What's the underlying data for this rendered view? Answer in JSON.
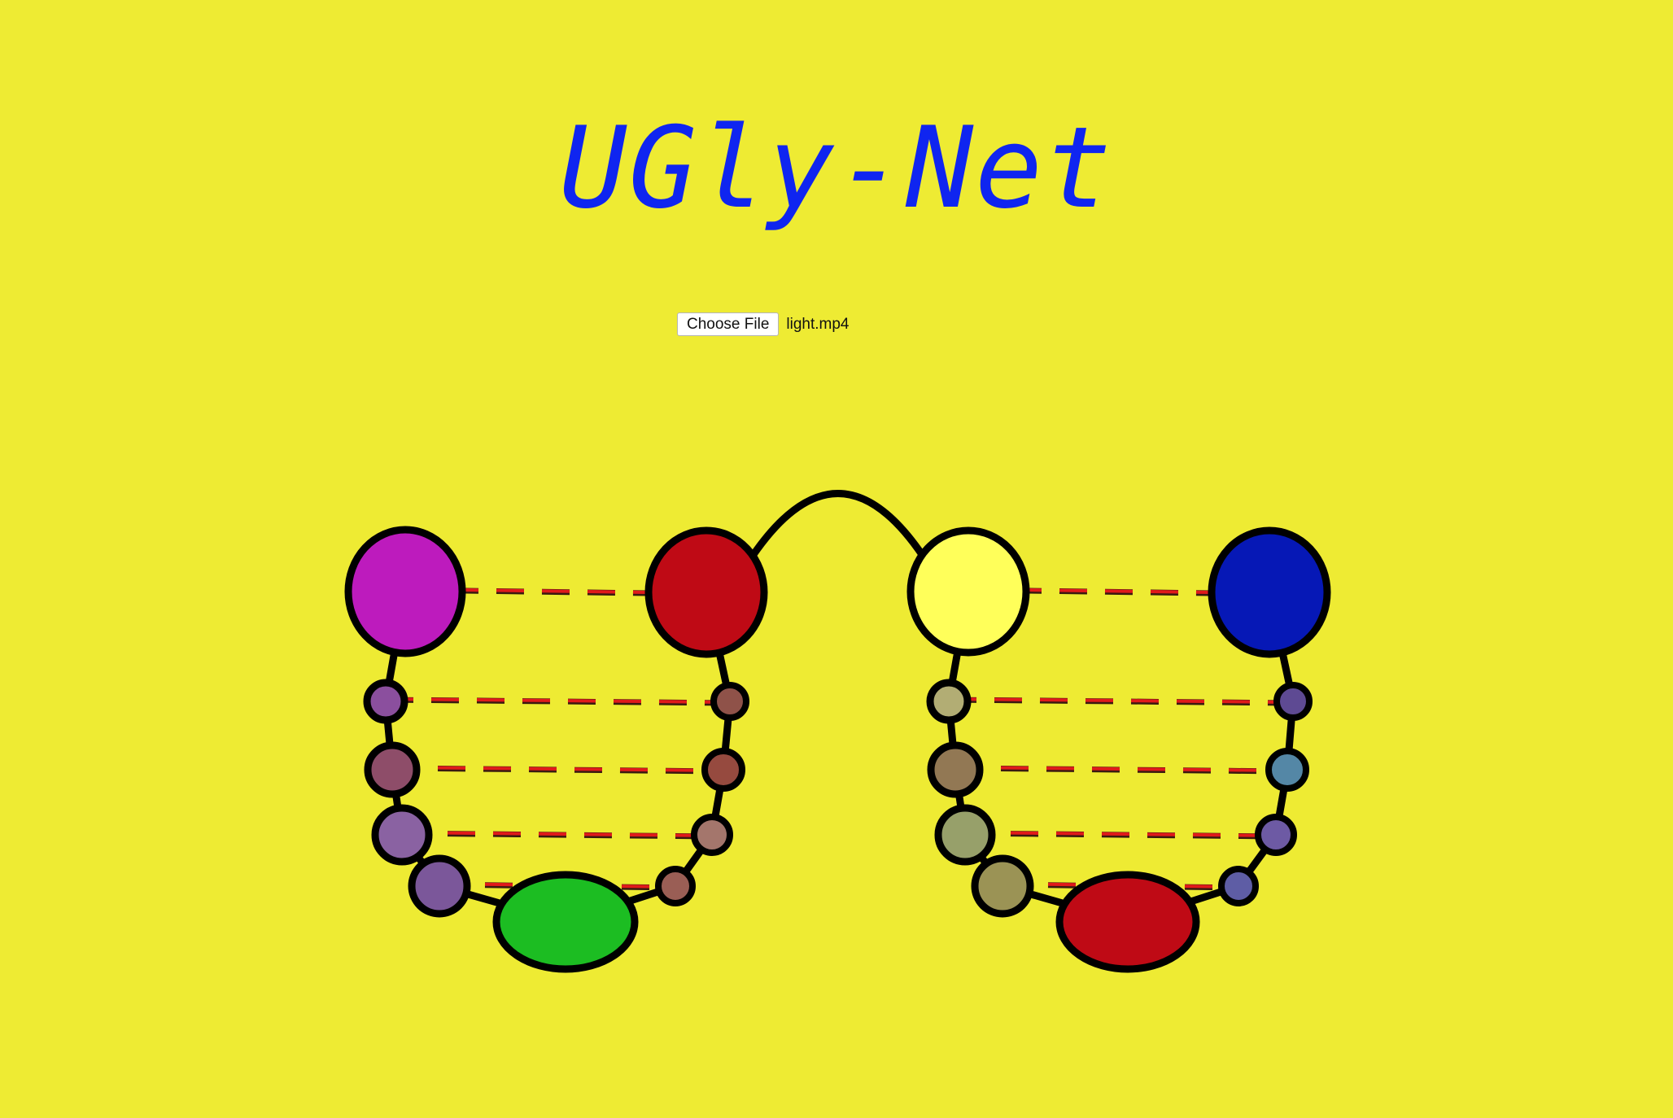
{
  "page": {
    "title": "UGly-Net",
    "background_color": "#eeeb33",
    "title_color": "#0f25f0"
  },
  "file_input": {
    "button_label": "Choose File",
    "file_name": "light.mp4"
  },
  "figure": {
    "link_color": "#000000",
    "skip_connection_color": "#e01a1a",
    "encoders": [
      {
        "big_node_color": "#bd1bbd",
        "chain_colors": [
          "#8b4f9e",
          "#8e4d69",
          "#8a62a2",
          "#7b579a"
        ],
        "bottom_node_color": "#1cbd22"
      },
      {
        "big_node_color": "#ffff5a",
        "chain_colors": [
          "#b2ad74",
          "#927854",
          "#97a06a",
          "#9b9355"
        ],
        "bottom_node_color": "#bf0a15"
      }
    ],
    "decoders": [
      {
        "big_node_color": "#bf0a15",
        "chain_colors": [
          "#8f5249",
          "#964a3f",
          "#a4766c",
          "#9a5e55"
        ]
      },
      {
        "big_node_color": "#0618b6",
        "chain_colors": [
          "#5e4a93",
          "#5487a6",
          "#6d5aa4",
          "#5e5da5"
        ]
      }
    ]
  }
}
